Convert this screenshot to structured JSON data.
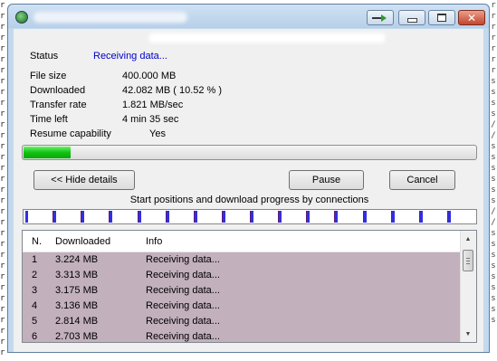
{
  "background": {
    "left_glyphs": [
      "r",
      "r",
      "r",
      "r",
      "r",
      "r",
      "r",
      "r",
      "r",
      "r",
      "r",
      "r",
      "r",
      "r",
      "r",
      "r",
      "r",
      "r",
      "r",
      "r",
      "r",
      "r",
      "r",
      "r",
      "r",
      "r",
      "r",
      "r",
      "r",
      "r",
      "r",
      "r",
      "r"
    ],
    "right_glyphs": [
      "r",
      "r",
      "r",
      "r",
      "r",
      "r",
      "r",
      "s",
      "s",
      "s",
      "s",
      "/",
      "/",
      "s",
      "s",
      "s",
      "s",
      "s",
      "s",
      "/",
      "/",
      "s",
      "s",
      "s",
      "s",
      "s",
      "s",
      "s",
      "s",
      "s"
    ]
  },
  "window": {
    "title": "",
    "url": ""
  },
  "details": {
    "status_label": "Status",
    "status_value": "Receiving data...",
    "file_size_label": "File size",
    "file_size_value": "400.000  MB",
    "downloaded_label": "Downloaded",
    "downloaded_value": "42.082  MB  ( 10.52 % )",
    "transfer_rate_label": "Transfer rate",
    "transfer_rate_value": "1.821  MB/sec",
    "time_left_label": "Time left",
    "time_left_value": "4 min 35 sec",
    "resume_label": "Resume capability",
    "resume_value": "Yes"
  },
  "progress": {
    "fraction": 0.1052
  },
  "buttons": {
    "hide_details": "<< Hide details",
    "pause": "Pause",
    "cancel": "Cancel"
  },
  "connections": {
    "caption": "Start positions and download progress by connections",
    "count": 16,
    "segment_progress": 0.105,
    "accent_color": "#3030e0"
  },
  "table": {
    "columns": [
      "N.",
      "Downloaded",
      "Info"
    ],
    "rows": [
      {
        "n": "1",
        "downloaded": "3.224  MB",
        "info": "Receiving data..."
      },
      {
        "n": "2",
        "downloaded": "3.313  MB",
        "info": "Receiving data..."
      },
      {
        "n": "3",
        "downloaded": "3.175  MB",
        "info": "Receiving data..."
      },
      {
        "n": "4",
        "downloaded": "3.136  MB",
        "info": "Receiving data..."
      },
      {
        "n": "5",
        "downloaded": "2.814  MB",
        "info": "Receiving data..."
      },
      {
        "n": "6",
        "downloaded": "2.703  MB",
        "info": "Receiving data..."
      }
    ]
  },
  "icons": {
    "app": "download-manager-icon",
    "download": "download-arrow-icon",
    "minimize": "minimize-icon",
    "maximize": "maximize-icon",
    "close": "close-icon"
  }
}
